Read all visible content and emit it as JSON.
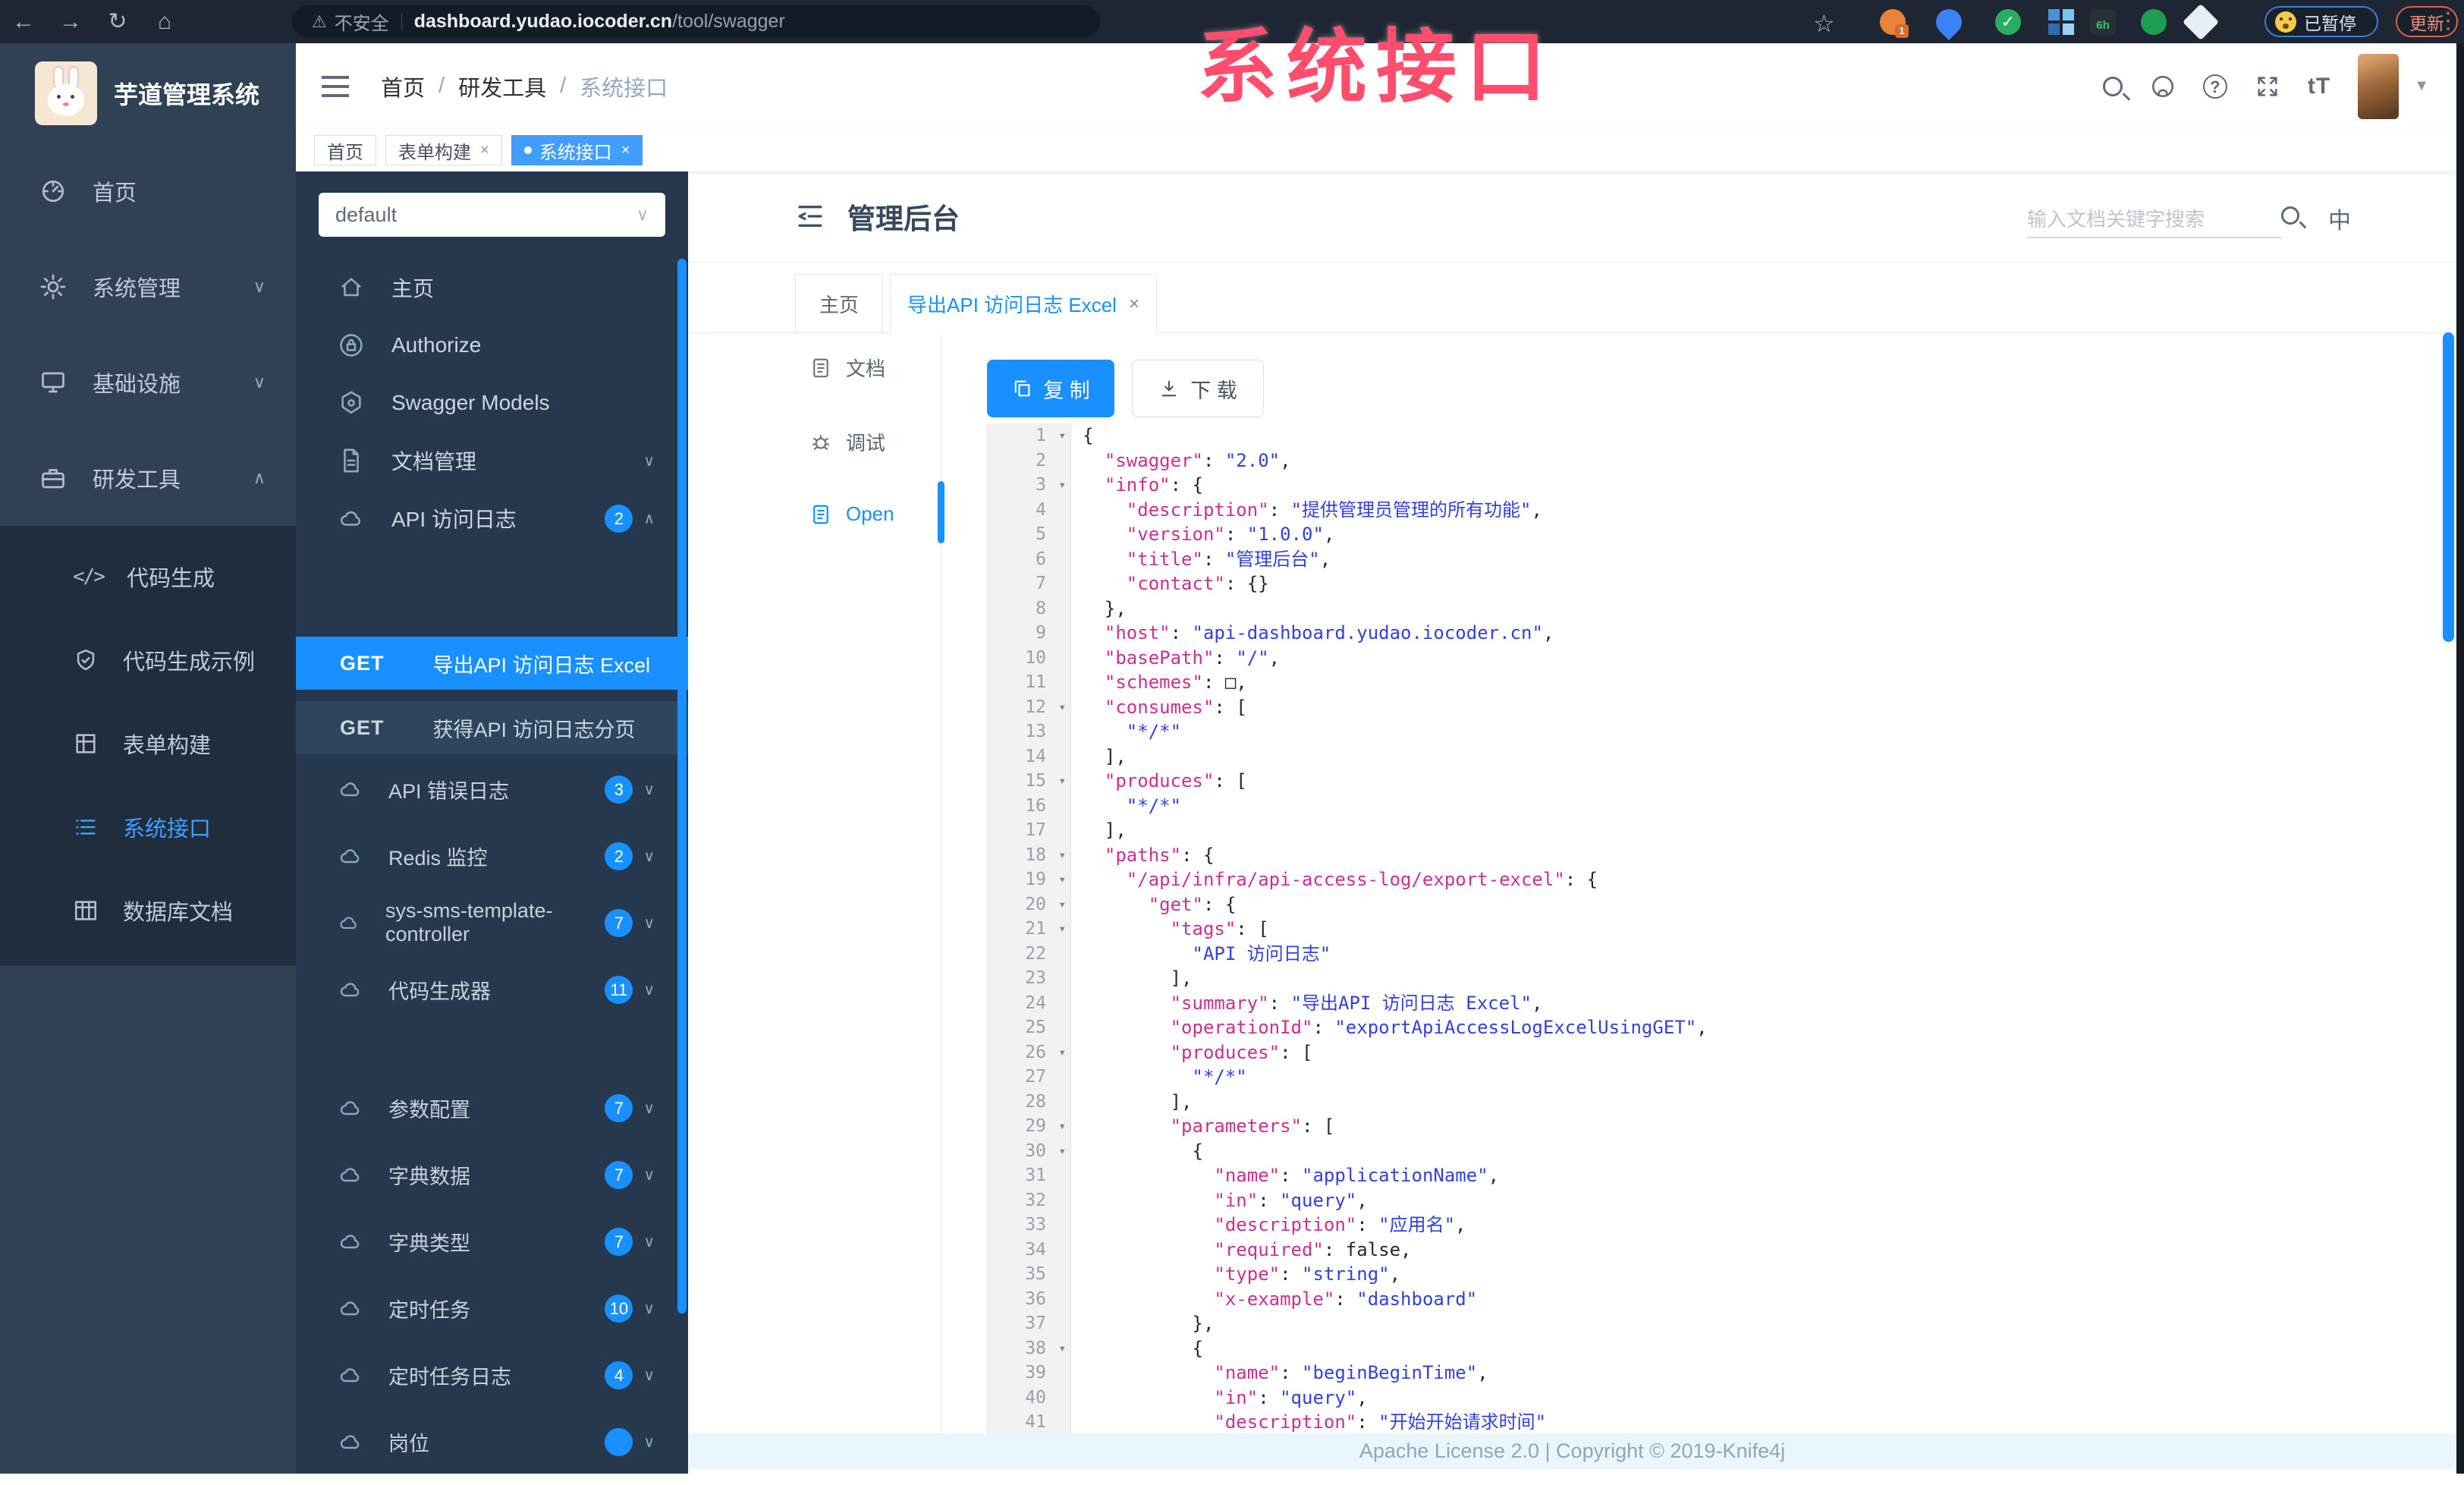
{
  "browser": {
    "back": "←",
    "forward": "→",
    "reload": "↻",
    "home": "⌂",
    "warning": "⚠",
    "security_label": "不安全",
    "url_host": "dashboard.yudao.iocoder.cn",
    "url_path": "/tool/swagger",
    "star": "☆",
    "ext_badge_1": "1",
    "ext_badge_6h": "6h",
    "ext_check": "✓",
    "paused_label": "已暂停",
    "update_label": "更新",
    "menu_dots": "⋮"
  },
  "overlay": {
    "title": "系统接口",
    "color": "#ff4d6e"
  },
  "sidebar": {
    "logo_title": "芋道管理系统",
    "menu": [
      {
        "label": "首页",
        "chevron": ""
      },
      {
        "label": "系统管理",
        "chevron": "∨"
      },
      {
        "label": "基础设施",
        "chevron": "∨"
      },
      {
        "label": "研发工具",
        "chevron": "∧"
      }
    ],
    "submenu": [
      {
        "label": "代码生成"
      },
      {
        "label": "代码生成示例"
      },
      {
        "label": "表单构建"
      },
      {
        "label": "系统接口",
        "active": true
      },
      {
        "label": "数据库文档"
      }
    ]
  },
  "header": {
    "breadcrumb": [
      "首页",
      "研发工具",
      "系统接口"
    ],
    "separator": "/",
    "font_icon": "tT",
    "caret": "▼"
  },
  "tags": [
    {
      "label": "首页"
    },
    {
      "label": "表单构建",
      "close": "×"
    },
    {
      "label": "系统接口",
      "close": "×"
    }
  ],
  "k4": {
    "group_select": "default",
    "select_chevron": "∨",
    "menu": [
      {
        "label": "主页"
      },
      {
        "label": "Authorize"
      },
      {
        "label": "Swagger Models"
      },
      {
        "label": "文档管理",
        "chevron": "∨"
      },
      {
        "label": "API 访问日志",
        "badge": "2",
        "chevron": "∧"
      }
    ],
    "operations": [
      {
        "method": "GET",
        "label": "导出API 访问日志 Excel",
        "active": true
      },
      {
        "method": "GET",
        "label": "获得API 访问日志分页",
        "active": false
      }
    ],
    "groups": [
      {
        "label": "API 错误日志",
        "badge": "3"
      },
      {
        "label": "Redis 监控",
        "badge": "2"
      },
      {
        "label": "sys-sms-template-controller",
        "badge": "7"
      },
      {
        "label": "代码生成器",
        "badge": "11"
      },
      {
        "label": "参数配置",
        "badge": "7",
        "gap": true
      },
      {
        "label": "字典数据",
        "badge": "7"
      },
      {
        "label": "字典类型",
        "badge": "7"
      },
      {
        "label": "定时任务",
        "badge": "10"
      },
      {
        "label": "定时任务日志",
        "badge": "4"
      },
      {
        "label": "岗位",
        "badge": ""
      }
    ],
    "chevron_down": "∨"
  },
  "doc": {
    "title": "管理后台",
    "search_placeholder": "输入文档关键字搜索",
    "lang_icon": "中",
    "tabs": [
      {
        "label": "主页"
      },
      {
        "label": "导出API 访问日志 Excel",
        "close": "×",
        "active": true
      }
    ],
    "rail": [
      {
        "label": "文档"
      },
      {
        "label": "调试"
      },
      {
        "label": "Open",
        "active": true
      }
    ],
    "copy_label": "复 制",
    "download_label": "下 载",
    "footer": "Apache License 2.0 | Copyright © 2019-Knife4j"
  },
  "code": {
    "lines": [
      {
        "n": 1,
        "f": true,
        "t": [
          [
            "p",
            "{"
          ]
        ]
      },
      {
        "n": 2,
        "f": false,
        "t": [
          [
            "p",
            "  "
          ],
          [
            "k",
            "\"swagger\""
          ],
          [
            "p",
            ": "
          ],
          [
            "s",
            "\"2.0\""
          ],
          [
            "p",
            ","
          ]
        ]
      },
      {
        "n": 3,
        "f": true,
        "t": [
          [
            "p",
            "  "
          ],
          [
            "k",
            "\"info\""
          ],
          [
            "p",
            ": {"
          ]
        ]
      },
      {
        "n": 4,
        "f": false,
        "t": [
          [
            "p",
            "    "
          ],
          [
            "k",
            "\"description\""
          ],
          [
            "p",
            ": "
          ],
          [
            "s",
            "\"提供管理员管理的所有功能\""
          ],
          [
            "p",
            ","
          ]
        ]
      },
      {
        "n": 5,
        "f": false,
        "t": [
          [
            "p",
            "    "
          ],
          [
            "k",
            "\"version\""
          ],
          [
            "p",
            ": "
          ],
          [
            "s",
            "\"1.0.0\""
          ],
          [
            "p",
            ","
          ]
        ]
      },
      {
        "n": 6,
        "f": false,
        "t": [
          [
            "p",
            "    "
          ],
          [
            "k",
            "\"title\""
          ],
          [
            "p",
            ": "
          ],
          [
            "s",
            "\"管理后台\""
          ],
          [
            "p",
            ","
          ]
        ]
      },
      {
        "n": 7,
        "f": false,
        "t": [
          [
            "p",
            "    "
          ],
          [
            "k",
            "\"contact\""
          ],
          [
            "p",
            ": {}"
          ]
        ]
      },
      {
        "n": 8,
        "f": false,
        "t": [
          [
            "p",
            "  },"
          ]
        ]
      },
      {
        "n": 9,
        "f": false,
        "t": [
          [
            "p",
            "  "
          ],
          [
            "k",
            "\"host\""
          ],
          [
            "p",
            ": "
          ],
          [
            "s",
            "\"api-dashboard.yudao.iocoder.cn\""
          ],
          [
            "p",
            ","
          ]
        ]
      },
      {
        "n": 10,
        "f": false,
        "t": [
          [
            "p",
            "  "
          ],
          [
            "k",
            "\"basePath\""
          ],
          [
            "p",
            ": "
          ],
          [
            "s",
            "\"/\""
          ],
          [
            "p",
            ","
          ]
        ]
      },
      {
        "n": 11,
        "f": false,
        "t": [
          [
            "p",
            "  "
          ],
          [
            "k",
            "\"schemes\""
          ],
          [
            "p",
            ": □,"
          ]
        ]
      },
      {
        "n": 12,
        "f": true,
        "t": [
          [
            "p",
            "  "
          ],
          [
            "k",
            "\"consumes\""
          ],
          [
            "p",
            ": ["
          ]
        ]
      },
      {
        "n": 13,
        "f": false,
        "t": [
          [
            "p",
            "    "
          ],
          [
            "s",
            "\"*/*\""
          ]
        ]
      },
      {
        "n": 14,
        "f": false,
        "t": [
          [
            "p",
            "  ],"
          ]
        ]
      },
      {
        "n": 15,
        "f": true,
        "t": [
          [
            "p",
            "  "
          ],
          [
            "k",
            "\"produces\""
          ],
          [
            "p",
            ": ["
          ]
        ]
      },
      {
        "n": 16,
        "f": false,
        "t": [
          [
            "p",
            "    "
          ],
          [
            "s",
            "\"*/*\""
          ]
        ]
      },
      {
        "n": 17,
        "f": false,
        "t": [
          [
            "p",
            "  ],"
          ]
        ]
      },
      {
        "n": 18,
        "f": true,
        "t": [
          [
            "p",
            "  "
          ],
          [
            "k",
            "\"paths\""
          ],
          [
            "p",
            ": {"
          ]
        ]
      },
      {
        "n": 19,
        "f": true,
        "t": [
          [
            "p",
            "    "
          ],
          [
            "k",
            "\"/api/infra/api-access-log/export-excel\""
          ],
          [
            "p",
            ": {"
          ]
        ]
      },
      {
        "n": 20,
        "f": true,
        "t": [
          [
            "p",
            "      "
          ],
          [
            "k",
            "\"get\""
          ],
          [
            "p",
            ": {"
          ]
        ]
      },
      {
        "n": 21,
        "f": true,
        "t": [
          [
            "p",
            "        "
          ],
          [
            "k",
            "\"tags\""
          ],
          [
            "p",
            ": ["
          ]
        ]
      },
      {
        "n": 22,
        "f": false,
        "t": [
          [
            "p",
            "          "
          ],
          [
            "s",
            "\"API 访问日志\""
          ]
        ]
      },
      {
        "n": 23,
        "f": false,
        "t": [
          [
            "p",
            "        ],"
          ]
        ]
      },
      {
        "n": 24,
        "f": false,
        "t": [
          [
            "p",
            "        "
          ],
          [
            "k",
            "\"summary\""
          ],
          [
            "p",
            ": "
          ],
          [
            "s",
            "\"导出API 访问日志 Excel\""
          ],
          [
            "p",
            ","
          ]
        ]
      },
      {
        "n": 25,
        "f": false,
        "t": [
          [
            "p",
            "        "
          ],
          [
            "k",
            "\"operationId\""
          ],
          [
            "p",
            ": "
          ],
          [
            "s",
            "\"exportApiAccessLogExcelUsingGET\""
          ],
          [
            "p",
            ","
          ]
        ]
      },
      {
        "n": 26,
        "f": true,
        "t": [
          [
            "p",
            "        "
          ],
          [
            "k",
            "\"produces\""
          ],
          [
            "p",
            ": ["
          ]
        ]
      },
      {
        "n": 27,
        "f": false,
        "t": [
          [
            "p",
            "          "
          ],
          [
            "s",
            "\"*/*\""
          ]
        ]
      },
      {
        "n": 28,
        "f": false,
        "t": [
          [
            "p",
            "        ],"
          ]
        ]
      },
      {
        "n": 29,
        "f": true,
        "t": [
          [
            "p",
            "        "
          ],
          [
            "k",
            "\"parameters\""
          ],
          [
            "p",
            ": ["
          ]
        ]
      },
      {
        "n": 30,
        "f": true,
        "t": [
          [
            "p",
            "          {"
          ]
        ]
      },
      {
        "n": 31,
        "f": false,
        "t": [
          [
            "p",
            "            "
          ],
          [
            "k",
            "\"name\""
          ],
          [
            "p",
            ": "
          ],
          [
            "s",
            "\"applicationName\""
          ],
          [
            "p",
            ","
          ]
        ]
      },
      {
        "n": 32,
        "f": false,
        "t": [
          [
            "p",
            "            "
          ],
          [
            "k",
            "\"in\""
          ],
          [
            "p",
            ": "
          ],
          [
            "s",
            "\"query\""
          ],
          [
            "p",
            ","
          ]
        ]
      },
      {
        "n": 33,
        "f": false,
        "t": [
          [
            "p",
            "            "
          ],
          [
            "k",
            "\"description\""
          ],
          [
            "p",
            ": "
          ],
          [
            "s",
            "\"应用名\""
          ],
          [
            "p",
            ","
          ]
        ]
      },
      {
        "n": 34,
        "f": false,
        "t": [
          [
            "p",
            "            "
          ],
          [
            "k",
            "\"required\""
          ],
          [
            "p",
            ": false,"
          ]
        ]
      },
      {
        "n": 35,
        "f": false,
        "t": [
          [
            "p",
            "            "
          ],
          [
            "k",
            "\"type\""
          ],
          [
            "p",
            ": "
          ],
          [
            "s",
            "\"string\""
          ],
          [
            "p",
            ","
          ]
        ]
      },
      {
        "n": 36,
        "f": false,
        "t": [
          [
            "p",
            "            "
          ],
          [
            "k",
            "\"x-example\""
          ],
          [
            "p",
            ": "
          ],
          [
            "s",
            "\"dashboard\""
          ]
        ]
      },
      {
        "n": 37,
        "f": false,
        "t": [
          [
            "p",
            "          },"
          ]
        ]
      },
      {
        "n": 38,
        "f": true,
        "t": [
          [
            "p",
            "          {"
          ]
        ]
      },
      {
        "n": 39,
        "f": false,
        "t": [
          [
            "p",
            "            "
          ],
          [
            "k",
            "\"name\""
          ],
          [
            "p",
            ": "
          ],
          [
            "s",
            "\"beginBeginTime\""
          ],
          [
            "p",
            ","
          ]
        ]
      },
      {
        "n": 40,
        "f": false,
        "t": [
          [
            "p",
            "            "
          ],
          [
            "k",
            "\"in\""
          ],
          [
            "p",
            ": "
          ],
          [
            "s",
            "\"query\""
          ],
          [
            "p",
            ","
          ]
        ]
      },
      {
        "n": 41,
        "f": false,
        "t": [
          [
            "p",
            "            "
          ],
          [
            "k",
            "\"description\""
          ],
          [
            "p",
            ": "
          ],
          [
            "s",
            "\"开始开始请求时间\""
          ]
        ]
      }
    ]
  }
}
